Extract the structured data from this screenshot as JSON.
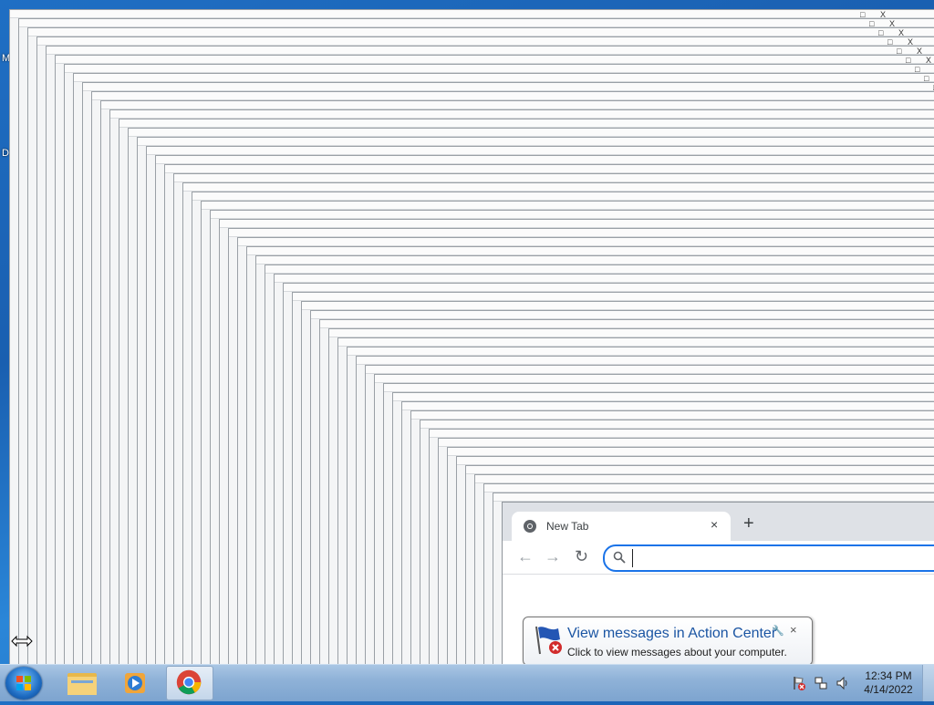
{
  "desktop": {
    "icon_letters": [
      "M",
      "D"
    ]
  },
  "background_window": {
    "title_controls": [
      "_",
      "□",
      "X"
    ]
  },
  "browser": {
    "tab_title": "New Tab",
    "tab_close": "×",
    "new_tab": "+",
    "back_icon": "arrow-left-icon",
    "forward_icon": "arrow-right-icon",
    "reload_icon": "reload-icon",
    "omnibox_value": ""
  },
  "notification": {
    "title": "View messages in Action Center",
    "text": "Click to view messages about your computer.",
    "close": "×"
  },
  "taskbar": {
    "apps": [
      "windows-explorer",
      "windows-media-player",
      "google-chrome"
    ],
    "active_app": "google-chrome",
    "clock_time": "12:34 PM",
    "clock_date": "4/14/2022"
  },
  "colors": {
    "desktop": "#1f6fc4",
    "chrome_accent": "#1a73e8",
    "balloon_title": "#1b55a3"
  }
}
